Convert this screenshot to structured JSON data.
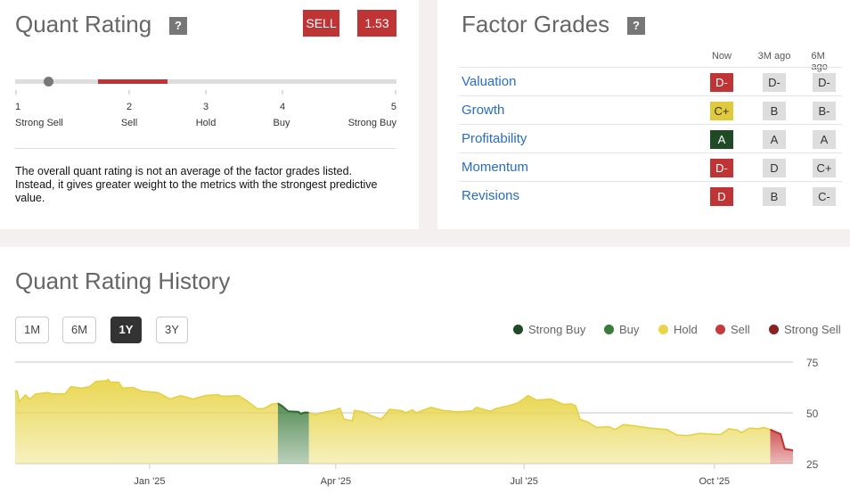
{
  "quant_rating": {
    "title": "Quant Rating",
    "help": "?",
    "rating_label": "SELL",
    "score": "1.53",
    "score_value": 1.53,
    "scale": [
      {
        "n": "1",
        "label": "Strong Sell"
      },
      {
        "n": "2",
        "label": "Sell"
      },
      {
        "n": "3",
        "label": "Hold"
      },
      {
        "n": "4",
        "label": "Buy"
      },
      {
        "n": "5",
        "label": "Strong Buy"
      }
    ],
    "description": "The overall quant rating is not an average of the factor grades listed. Instead, it gives greater weight to the metrics with the strongest predictive value."
  },
  "factor_grades": {
    "title": "Factor Grades",
    "help": "?",
    "columns": [
      "Now",
      "3M ago",
      "6M ago"
    ],
    "rows": [
      {
        "label": "Valuation",
        "now": "D-",
        "m3": "D-",
        "m6": "D-",
        "now_color": "#bf3535",
        "now_text": "#fff"
      },
      {
        "label": "Growth",
        "now": "C+",
        "m3": "B",
        "m6": "B-",
        "now_color": "#e0c93a",
        "now_text": "#333"
      },
      {
        "label": "Profitability",
        "now": "A",
        "m3": "A",
        "m6": "A",
        "now_color": "#1e4a25",
        "now_text": "#fff"
      },
      {
        "label": "Momentum",
        "now": "D-",
        "m3": "D",
        "m6": "C+",
        "now_color": "#bf3535",
        "now_text": "#fff"
      },
      {
        "label": "Revisions",
        "now": "D",
        "m3": "B",
        "m6": "C-",
        "now_color": "#bf3535",
        "now_text": "#fff"
      }
    ]
  },
  "history": {
    "title": "Quant Rating History",
    "ranges": [
      "1M",
      "6M",
      "1Y",
      "3Y"
    ],
    "active_range": "1Y",
    "legend": [
      {
        "label": "Strong Buy",
        "color": "#1e4a25"
      },
      {
        "label": "Buy",
        "color": "#3a7a3a"
      },
      {
        "label": "Hold",
        "color": "#e8d54a"
      },
      {
        "label": "Sell",
        "color": "#c83a3a"
      },
      {
        "label": "Strong Sell",
        "color": "#8a2020"
      }
    ]
  },
  "chart_data": {
    "type": "area",
    "xlabel": "",
    "ylabel": "",
    "ylim": [
      25,
      75
    ],
    "yticks": [
      "75",
      "50",
      "25"
    ],
    "xticks": [
      {
        "label": "Jan '25",
        "day": 65
      },
      {
        "label": "Apr '25",
        "day": 155
      },
      {
        "label": "Jul '25",
        "day": 246
      },
      {
        "label": "Oct '25",
        "day": 338
      }
    ],
    "x_unit": "days since start (~Oct 28 2024)",
    "series": [
      {
        "name": "Hold",
        "color": "#e8d54a",
        "points": [
          [
            0,
            61
          ],
          [
            1,
            60.7
          ],
          [
            2,
            55.6
          ],
          [
            5,
            58.8
          ],
          [
            7,
            56.8
          ],
          [
            10,
            59.3
          ],
          [
            16,
            60
          ],
          [
            18,
            59.3
          ],
          [
            24,
            59.3
          ],
          [
            27,
            62.9
          ],
          [
            32,
            62.2
          ],
          [
            36,
            62.9
          ],
          [
            39,
            65.5
          ],
          [
            44,
            65.8
          ],
          [
            45,
            66.5
          ],
          [
            46,
            65.1
          ],
          [
            50,
            65.1
          ],
          [
            52,
            62.2
          ],
          [
            57,
            62.5
          ],
          [
            61,
            60.7
          ],
          [
            69,
            60
          ],
          [
            75,
            56.8
          ],
          [
            80,
            58.5
          ],
          [
            86,
            56.8
          ],
          [
            92,
            58.5
          ],
          [
            98,
            59
          ],
          [
            100,
            58.2
          ],
          [
            103,
            58.2
          ],
          [
            108,
            58.5
          ],
          [
            112,
            55.9
          ],
          [
            117,
            52
          ],
          [
            120,
            52
          ],
          [
            124,
            54.2
          ],
          [
            127,
            54.7
          ]
        ]
      },
      {
        "name": "Buy",
        "color": "#3a7a3a",
        "points": [
          [
            127,
            54.7
          ],
          [
            129,
            53.4
          ],
          [
            132,
            50.8
          ],
          [
            137,
            50.5
          ],
          [
            138,
            49.5
          ],
          [
            140,
            50.2
          ],
          [
            142,
            50.1
          ]
        ]
      },
      {
        "name": "Hold",
        "color": "#e8d54a",
        "points": [
          [
            142,
            50.1
          ],
          [
            145,
            49.1
          ],
          [
            150,
            50.5
          ],
          [
            154,
            51.2
          ],
          [
            157,
            52.3
          ],
          [
            159,
            46.9
          ],
          [
            163,
            46.1
          ],
          [
            164,
            51.2
          ],
          [
            168,
            50.5
          ],
          [
            173,
            48.3
          ],
          [
            177,
            46.9
          ],
          [
            181,
            51.7
          ],
          [
            187,
            51
          ],
          [
            189,
            50.1
          ],
          [
            192,
            51.5
          ],
          [
            194,
            50.1
          ],
          [
            201,
            52.7
          ],
          [
            207,
            51.2
          ],
          [
            214,
            50.5
          ],
          [
            221,
            51
          ],
          [
            223,
            52.7
          ],
          [
            227,
            51.5
          ],
          [
            230,
            50.8
          ],
          [
            232,
            52
          ],
          [
            238,
            53.4
          ],
          [
            243,
            54.9
          ],
          [
            248,
            58.5
          ],
          [
            252,
            56.3
          ],
          [
            259,
            56.8
          ],
          [
            265,
            54.2
          ],
          [
            269,
            54.4
          ],
          [
            271,
            53.4
          ],
          [
            273,
            46.9
          ],
          [
            277,
            45.4
          ],
          [
            281,
            42.8
          ],
          [
            287,
            43.2
          ],
          [
            290,
            41.8
          ],
          [
            294,
            44.2
          ],
          [
            299,
            43.7
          ],
          [
            307,
            42.5
          ],
          [
            315,
            41.8
          ],
          [
            320,
            39.1
          ],
          [
            325,
            38.8
          ],
          [
            331,
            39.9
          ],
          [
            336,
            39.6
          ],
          [
            341,
            39.3
          ],
          [
            345,
            42.2
          ],
          [
            349,
            41.6
          ],
          [
            351,
            40.3
          ],
          [
            355,
            42.5
          ],
          [
            359,
            42.2
          ],
          [
            362,
            42.8
          ],
          [
            365,
            41.8
          ]
        ]
      },
      {
        "name": "Sell",
        "color": "#c83a3a",
        "points": [
          [
            365,
            41.8
          ],
          [
            366,
            41.3
          ],
          [
            370,
            39.6
          ],
          [
            372,
            32.3
          ],
          [
            376,
            31.6
          ]
        ]
      }
    ]
  }
}
